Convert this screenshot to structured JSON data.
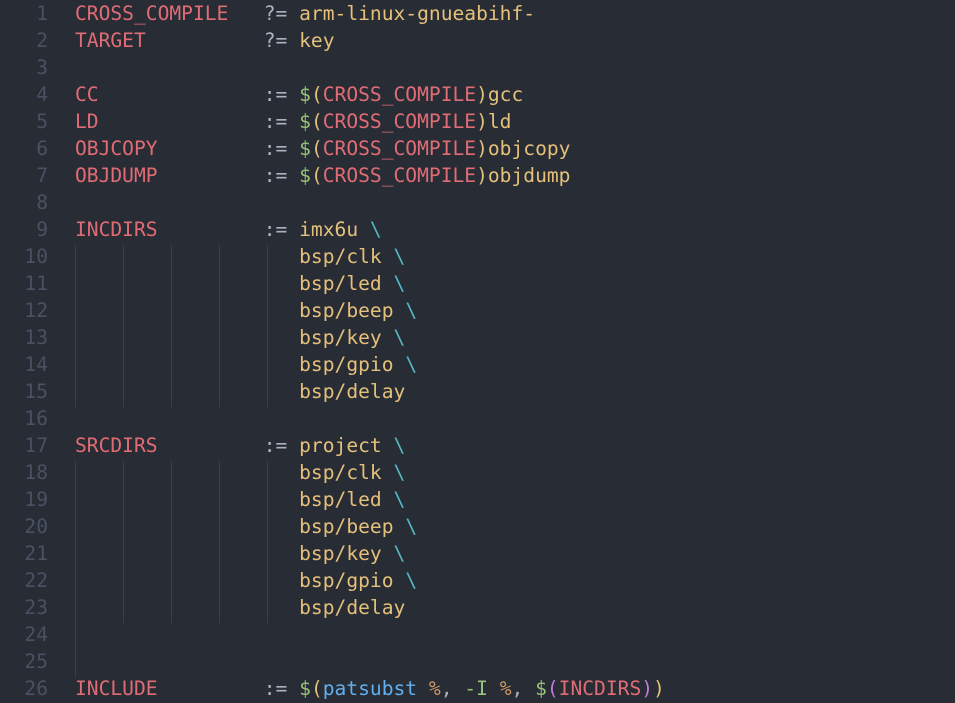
{
  "theme": {
    "background": "#282c34",
    "line_number": "#495162",
    "indent_guide": "#3b4048",
    "token_colors": {
      "var": "#e06c75",
      "op": "#abb2bf",
      "str": "#e5c07b",
      "dollar": "#98c379",
      "paren": "#e5c07b",
      "paren2": "#c678dd",
      "esc": "#56b6c2",
      "func": "#61afef",
      "flag": "#98c379",
      "pct": "#d19a66"
    }
  },
  "editor": {
    "lines": [
      {
        "n": "1",
        "tokens": [
          [
            "var",
            "CROSS_COMPILE"
          ],
          [
            "op",
            "   ?= "
          ],
          [
            "str",
            "arm-linux-gnueabihf-"
          ]
        ]
      },
      {
        "n": "2",
        "tokens": [
          [
            "var",
            "TARGET"
          ],
          [
            "op",
            "          ?= "
          ],
          [
            "str",
            "key"
          ]
        ]
      },
      {
        "n": "3",
        "tokens": []
      },
      {
        "n": "4",
        "tokens": [
          [
            "var",
            "CC"
          ],
          [
            "op",
            "              := "
          ],
          [
            "dollar",
            "$"
          ],
          [
            "paren",
            "("
          ],
          [
            "var",
            "CROSS_COMPILE"
          ],
          [
            "paren",
            ")"
          ],
          [
            "str",
            "gcc"
          ]
        ]
      },
      {
        "n": "5",
        "tokens": [
          [
            "var",
            "LD"
          ],
          [
            "op",
            "              := "
          ],
          [
            "dollar",
            "$"
          ],
          [
            "paren",
            "("
          ],
          [
            "var",
            "CROSS_COMPILE"
          ],
          [
            "paren",
            ")"
          ],
          [
            "str",
            "ld"
          ]
        ]
      },
      {
        "n": "6",
        "tokens": [
          [
            "var",
            "OBJCOPY"
          ],
          [
            "op",
            "         := "
          ],
          [
            "dollar",
            "$"
          ],
          [
            "paren",
            "("
          ],
          [
            "var",
            "CROSS_COMPILE"
          ],
          [
            "paren",
            ")"
          ],
          [
            "str",
            "objcopy"
          ]
        ]
      },
      {
        "n": "7",
        "tokens": [
          [
            "var",
            "OBJDUMP"
          ],
          [
            "op",
            "         := "
          ],
          [
            "dollar",
            "$"
          ],
          [
            "paren",
            "("
          ],
          [
            "var",
            "CROSS_COMPILE"
          ],
          [
            "paren",
            ")"
          ],
          [
            "str",
            "objdump"
          ]
        ]
      },
      {
        "n": "8",
        "tokens": []
      },
      {
        "n": "9",
        "tokens": [
          [
            "var",
            "INCDIRS"
          ],
          [
            "op",
            "         := "
          ],
          [
            "str",
            "imx6u "
          ],
          [
            "esc",
            "\\"
          ]
        ]
      },
      {
        "n": "10",
        "tokens": [
          [
            "op",
            "                   "
          ],
          [
            "str",
            "bsp/clk "
          ],
          [
            "esc",
            "\\"
          ]
        ]
      },
      {
        "n": "11",
        "tokens": [
          [
            "op",
            "                   "
          ],
          [
            "str",
            "bsp/led "
          ],
          [
            "esc",
            "\\"
          ]
        ]
      },
      {
        "n": "12",
        "tokens": [
          [
            "op",
            "                   "
          ],
          [
            "str",
            "bsp/beep "
          ],
          [
            "esc",
            "\\"
          ]
        ]
      },
      {
        "n": "13",
        "tokens": [
          [
            "op",
            "                   "
          ],
          [
            "str",
            "bsp/key "
          ],
          [
            "esc",
            "\\"
          ]
        ]
      },
      {
        "n": "14",
        "tokens": [
          [
            "op",
            "                   "
          ],
          [
            "str",
            "bsp/gpio "
          ],
          [
            "esc",
            "\\"
          ]
        ]
      },
      {
        "n": "15",
        "tokens": [
          [
            "op",
            "                   "
          ],
          [
            "str",
            "bsp/delay"
          ]
        ]
      },
      {
        "n": "16",
        "tokens": []
      },
      {
        "n": "17",
        "tokens": [
          [
            "var",
            "SRCDIRS"
          ],
          [
            "op",
            "         := "
          ],
          [
            "str",
            "project "
          ],
          [
            "esc",
            "\\"
          ]
        ]
      },
      {
        "n": "18",
        "tokens": [
          [
            "op",
            "                   "
          ],
          [
            "str",
            "bsp/clk "
          ],
          [
            "esc",
            "\\"
          ]
        ]
      },
      {
        "n": "19",
        "tokens": [
          [
            "op",
            "                   "
          ],
          [
            "str",
            "bsp/led "
          ],
          [
            "esc",
            "\\"
          ]
        ]
      },
      {
        "n": "20",
        "tokens": [
          [
            "op",
            "                   "
          ],
          [
            "str",
            "bsp/beep "
          ],
          [
            "esc",
            "\\"
          ]
        ]
      },
      {
        "n": "21",
        "tokens": [
          [
            "op",
            "                   "
          ],
          [
            "str",
            "bsp/key "
          ],
          [
            "esc",
            "\\"
          ]
        ]
      },
      {
        "n": "22",
        "tokens": [
          [
            "op",
            "                   "
          ],
          [
            "str",
            "bsp/gpio "
          ],
          [
            "esc",
            "\\"
          ]
        ]
      },
      {
        "n": "23",
        "tokens": [
          [
            "op",
            "                   "
          ],
          [
            "str",
            "bsp/delay"
          ]
        ]
      },
      {
        "n": "24",
        "tokens": []
      },
      {
        "n": "25",
        "tokens": []
      },
      {
        "n": "26",
        "tokens": [
          [
            "var",
            "INCLUDE"
          ],
          [
            "op",
            "         := "
          ],
          [
            "dollar",
            "$"
          ],
          [
            "paren",
            "("
          ],
          [
            "func",
            "patsubst "
          ],
          [
            "pct",
            "%"
          ],
          [
            "op",
            ", "
          ],
          [
            "flag",
            "-I "
          ],
          [
            "pct",
            "%"
          ],
          [
            "op",
            ", "
          ],
          [
            "dollar",
            "$"
          ],
          [
            "paren2",
            "("
          ],
          [
            "var",
            "INCDIRS"
          ],
          [
            "paren2",
            ")"
          ],
          [
            "paren",
            ")"
          ]
        ]
      }
    ]
  }
}
